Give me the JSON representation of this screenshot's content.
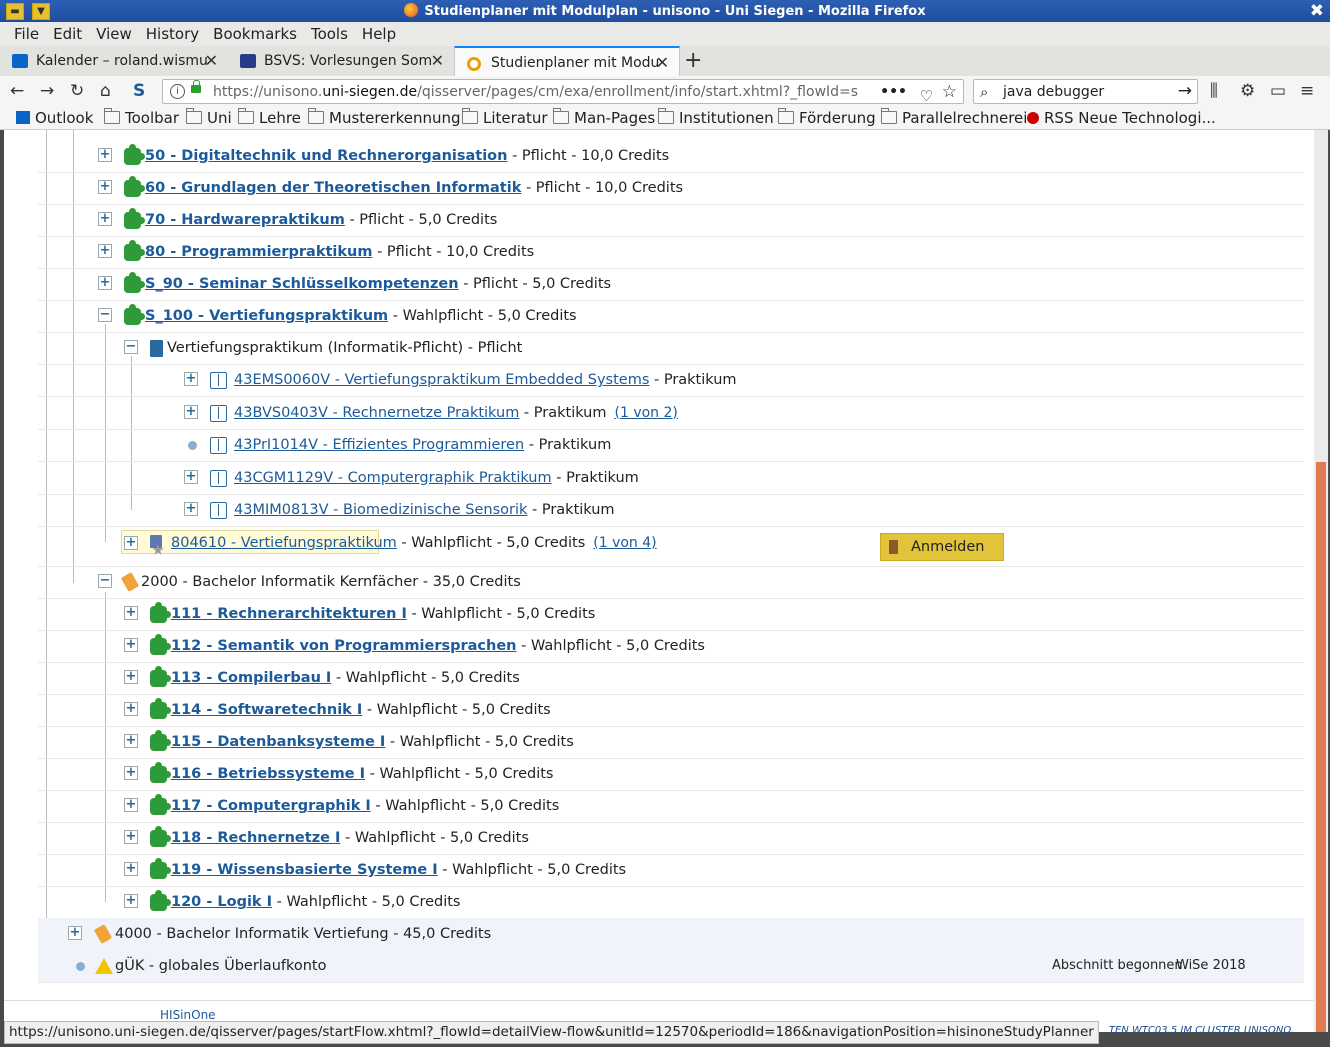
{
  "window": {
    "title": "Studienplaner mit Modulplan - unisono - Uni Siegen - Mozilla Firefox"
  },
  "menu": [
    "File",
    "Edit",
    "View",
    "History",
    "Bookmarks",
    "Tools",
    "Help"
  ],
  "tabs": [
    {
      "label": "Kalender – roland.wismu",
      "color": "#0a64c8"
    },
    {
      "label": "BSVS: Vorlesungen Som",
      "color": "#283c8c"
    },
    {
      "label": "Studienplaner mit Modu",
      "color": "#e8a000"
    }
  ],
  "url": {
    "host": "https://unisono.",
    "domain": "uni-siegen.de",
    "path": "/qisserver/pages/cm/exa/enrollment/info/start.xhtml?_flowId=s"
  },
  "search": {
    "value": "java debugger"
  },
  "bookmarks": [
    "Outlook",
    "Toolbar",
    "Uni",
    "Lehre",
    "Mustererkennung",
    "Literatur",
    "Man-Pages",
    "Institutionen",
    "Förderung",
    "Parallelrechnerei",
    "RSS Neue Technologi..."
  ],
  "tree": {
    "modules1": [
      {
        "link": "50 - Digitaltechnik und Rechnerorganisation",
        "rest": " - Pflicht - 10,0 Credits"
      },
      {
        "link": "60 - Grundlagen der Theoretischen Informatik",
        "rest": " - Pflicht - 10,0 Credits"
      },
      {
        "link": "70 - Hardwarepraktikum",
        "rest": " - Pflicht - 5,0 Credits"
      },
      {
        "link": "80 - Programmierpraktikum",
        "rest": " - Pflicht - 10,0 Credits"
      },
      {
        "link": "S_90 - Seminar Schlüsselkompetenzen",
        "rest": " - Pflicht - 5,0 Credits"
      },
      {
        "link": "S_100 - Vertiefungspraktikum",
        "rest": " - Wahlpflicht - 5,0 Credits"
      }
    ],
    "sub_heading": "Vertiefungspraktikum (Informatik-Pflicht) - Pflicht",
    "courses": [
      {
        "link": "43EMS0060V - Vertiefungspraktikum Embedded Systems",
        "rest": " - Praktikum",
        "count": ""
      },
      {
        "link": "43BVS0403V - Rechnernetze Praktikum",
        "rest": " - Praktikum",
        "count": "(1 von 2)"
      },
      {
        "link": "43PrI1014V - Effizientes Programmieren",
        "rest": " - Praktikum",
        "count": ""
      },
      {
        "link": "43CGM1129V - Computergraphik Praktikum",
        "rest": " - Praktikum",
        "count": ""
      },
      {
        "link": "43MIM0813V - Biomedizinische Sensorik",
        "rest": " - Praktikum",
        "count": ""
      }
    ],
    "exam": {
      "link": "804610 - Vertiefungspraktikum",
      "rest": " - Wahlpflicht - 5,0 Credits",
      "count": "(1 von 4)",
      "button": "Anmelden"
    },
    "group2000": "2000 - Bachelor Informatik Kernfächer - 35,0 Credits",
    "modules2": [
      {
        "link": "111 - Rechnerarchitekturen I",
        "rest": " - Wahlpflicht - 5,0 Credits"
      },
      {
        "link": "112 - Semantik von Programmiersprachen",
        "rest": " - Wahlpflicht - 5,0 Credits"
      },
      {
        "link": "113 - Compilerbau I",
        "rest": " - Wahlpflicht - 5,0 Credits"
      },
      {
        "link": "114 - Softwaretechnik I",
        "rest": " - Wahlpflicht - 5,0 Credits"
      },
      {
        "link": "115 - Datenbanksysteme I",
        "rest": " - Wahlpflicht - 5,0 Credits"
      },
      {
        "link": "116 - Betriebssysteme I",
        "rest": " - Wahlpflicht - 5,0 Credits"
      },
      {
        "link": "117 - Computergraphik I",
        "rest": " - Wahlpflicht - 5,0 Credits"
      },
      {
        "link": "118 - Rechnernetze I",
        "rest": " - Wahlpflicht - 5,0 Credits"
      },
      {
        "link": "119 - Wissensbasierte Systeme I",
        "rest": " - Wahlpflicht - 5,0 Credits"
      },
      {
        "link": "120 - Logik I",
        "rest": " - Wahlpflicht - 5,0 Credits"
      }
    ],
    "group4000": "4000 - Bachelor Informatik Vertiefung - 45,0 Credits",
    "guek": "gÜK - globales Überlaufkonto",
    "guek_action": "Abschnitt begonnen",
    "guek_term": "WiSe 2018"
  },
  "footer": {
    "logo": "HISinOne",
    "right": "TEN WTC03.5 IM CLUSTER UNISONO."
  },
  "status_url": "https://unisono.uni-siegen.de/qisserver/pages/startFlow.xhtml?_flowId=detailView-flow&unitId=12570&periodId=186&navigationPosition=hisinoneStudyPlanner"
}
